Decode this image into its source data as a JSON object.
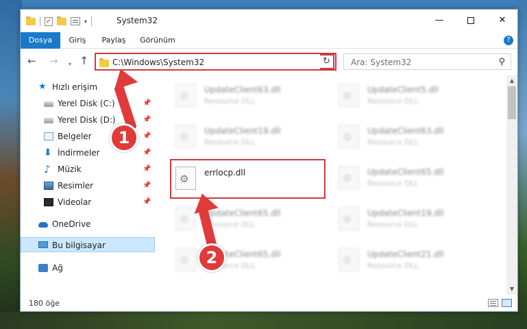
{
  "window": {
    "title": "System32",
    "minimize_glyph": "—",
    "close_glyph": "✕"
  },
  "ribbon": {
    "tabs": [
      {
        "label": "Dosya",
        "active": true
      },
      {
        "label": "Giriş",
        "active": false
      },
      {
        "label": "Paylaş",
        "active": false
      },
      {
        "label": "Görünüm",
        "active": false
      }
    ],
    "help_glyph": "?"
  },
  "navigation": {
    "back_glyph": "←",
    "forward_glyph": "→",
    "recent_glyph": "▾",
    "up_glyph": "↑",
    "address": "C:\\Windows\\System32",
    "address_dropdown_glyph": "⌄",
    "refresh_glyph": "↻",
    "search_placeholder": "Ara: System32",
    "search_glyph": "⚲"
  },
  "sidebar": {
    "items": [
      {
        "label": "Hızlı erişim",
        "icon": "star-icon",
        "pinned": false
      },
      {
        "label": "Yerel Disk (C:)",
        "icon": "drive-icon",
        "pinned": true
      },
      {
        "label": "Yerel Disk (D:)",
        "icon": "drive-icon",
        "pinned": true
      },
      {
        "label": "Belgeler",
        "icon": "documents-icon",
        "pinned": true
      },
      {
        "label": "İndirmeler",
        "icon": "downloads-icon",
        "pinned": true
      },
      {
        "label": "Müzik",
        "icon": "music-icon",
        "pinned": true
      },
      {
        "label": "Resimler",
        "icon": "pictures-icon",
        "pinned": true
      },
      {
        "label": "Videolar",
        "icon": "videos-icon",
        "pinned": true
      },
      {
        "label": "OneDrive",
        "icon": "onedrive-icon",
        "pinned": false
      },
      {
        "label": "Bu bilgisayar",
        "icon": "this-pc-icon",
        "pinned": false,
        "selected": true
      },
      {
        "label": "Ağ",
        "icon": "network-icon",
        "pinned": false
      }
    ],
    "pin_glyph": "📌"
  },
  "files": [
    {
      "name": "UpdateClient63.dll",
      "desc": "Resource DLL",
      "blurred": true
    },
    {
      "name": "UpdateClient5.dll",
      "desc": "Resource DLL",
      "blurred": true
    },
    {
      "name": "UpdateClient19.dll",
      "desc": "Resource DLL",
      "blurred": true
    },
    {
      "name": "UpdateClient63.dll",
      "desc": "Resource DLL",
      "blurred": true
    },
    {
      "name": "errlocp.dll",
      "desc": "",
      "blurred": false
    },
    {
      "name": "UpdateClient65.dll",
      "desc": "Resource DLL",
      "blurred": true
    },
    {
      "name": "UpdateClient65.dll",
      "desc": "Resource DLL",
      "blurred": true
    },
    {
      "name": "UpdateClient19.dll",
      "desc": "Resource DLL",
      "blurred": true
    },
    {
      "name": "UpdateClient65.dll",
      "desc": "Resource DLL",
      "blurred": true
    },
    {
      "name": "UpdateClient21.dll",
      "desc": "Resource DLL",
      "blurred": true
    }
  ],
  "status": {
    "item_count": "180 öğe"
  },
  "annotations": {
    "step1": "1",
    "step2": "2",
    "color": "#e03a3a"
  },
  "colors": {
    "accent": "#1979ca",
    "highlight_border": "#d0393e"
  }
}
